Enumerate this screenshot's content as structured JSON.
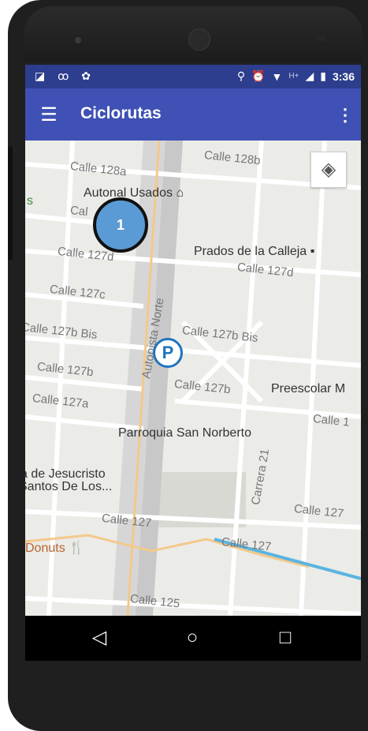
{
  "statusbar": {
    "left_icons": "◪ ꝏ ✿",
    "right_icons": [
      "location-icon",
      "alarm-icon",
      "wifi-icon",
      "H+",
      "signal-icon",
      "battery-icon"
    ],
    "network_label": "H+",
    "time": "3:36"
  },
  "appbar": {
    "title": "Ciclorutas",
    "menu_icon": "☰",
    "overflow_icon": "⋮"
  },
  "map": {
    "streets": [
      "Calle 128a",
      "Calle 128b",
      "Calle 127d",
      "Calle 127d",
      "Calle 127c",
      "Calle 127b Bis",
      "Calle 127b Bis",
      "Calle 127b",
      "Calle 127b",
      "Calle 127a",
      "Calle 1",
      "Calle 127",
      "Calle 127",
      "Calle 127",
      "Calle 125",
      "Autopista Norte",
      "Carrera 21",
      "Cal"
    ],
    "places": [
      "Autonal Usados",
      "Prados de la Calleja",
      "Preescolar M",
      "Parroquia San Norberto",
      "a de Jesucristo",
      "Santos De Los...",
      "Donuts",
      "s"
    ],
    "marker_label": "1",
    "parking_label": "P",
    "location_icon": "◈"
  },
  "fab": {
    "label": "+"
  },
  "navbar": {
    "back": "◁",
    "home": "○",
    "recents": "□"
  },
  "colors": {
    "appbar": "#3f51b5",
    "statusbar": "#2d3e8e",
    "fab": "#1b9880",
    "marker": "#5b9bd5"
  }
}
